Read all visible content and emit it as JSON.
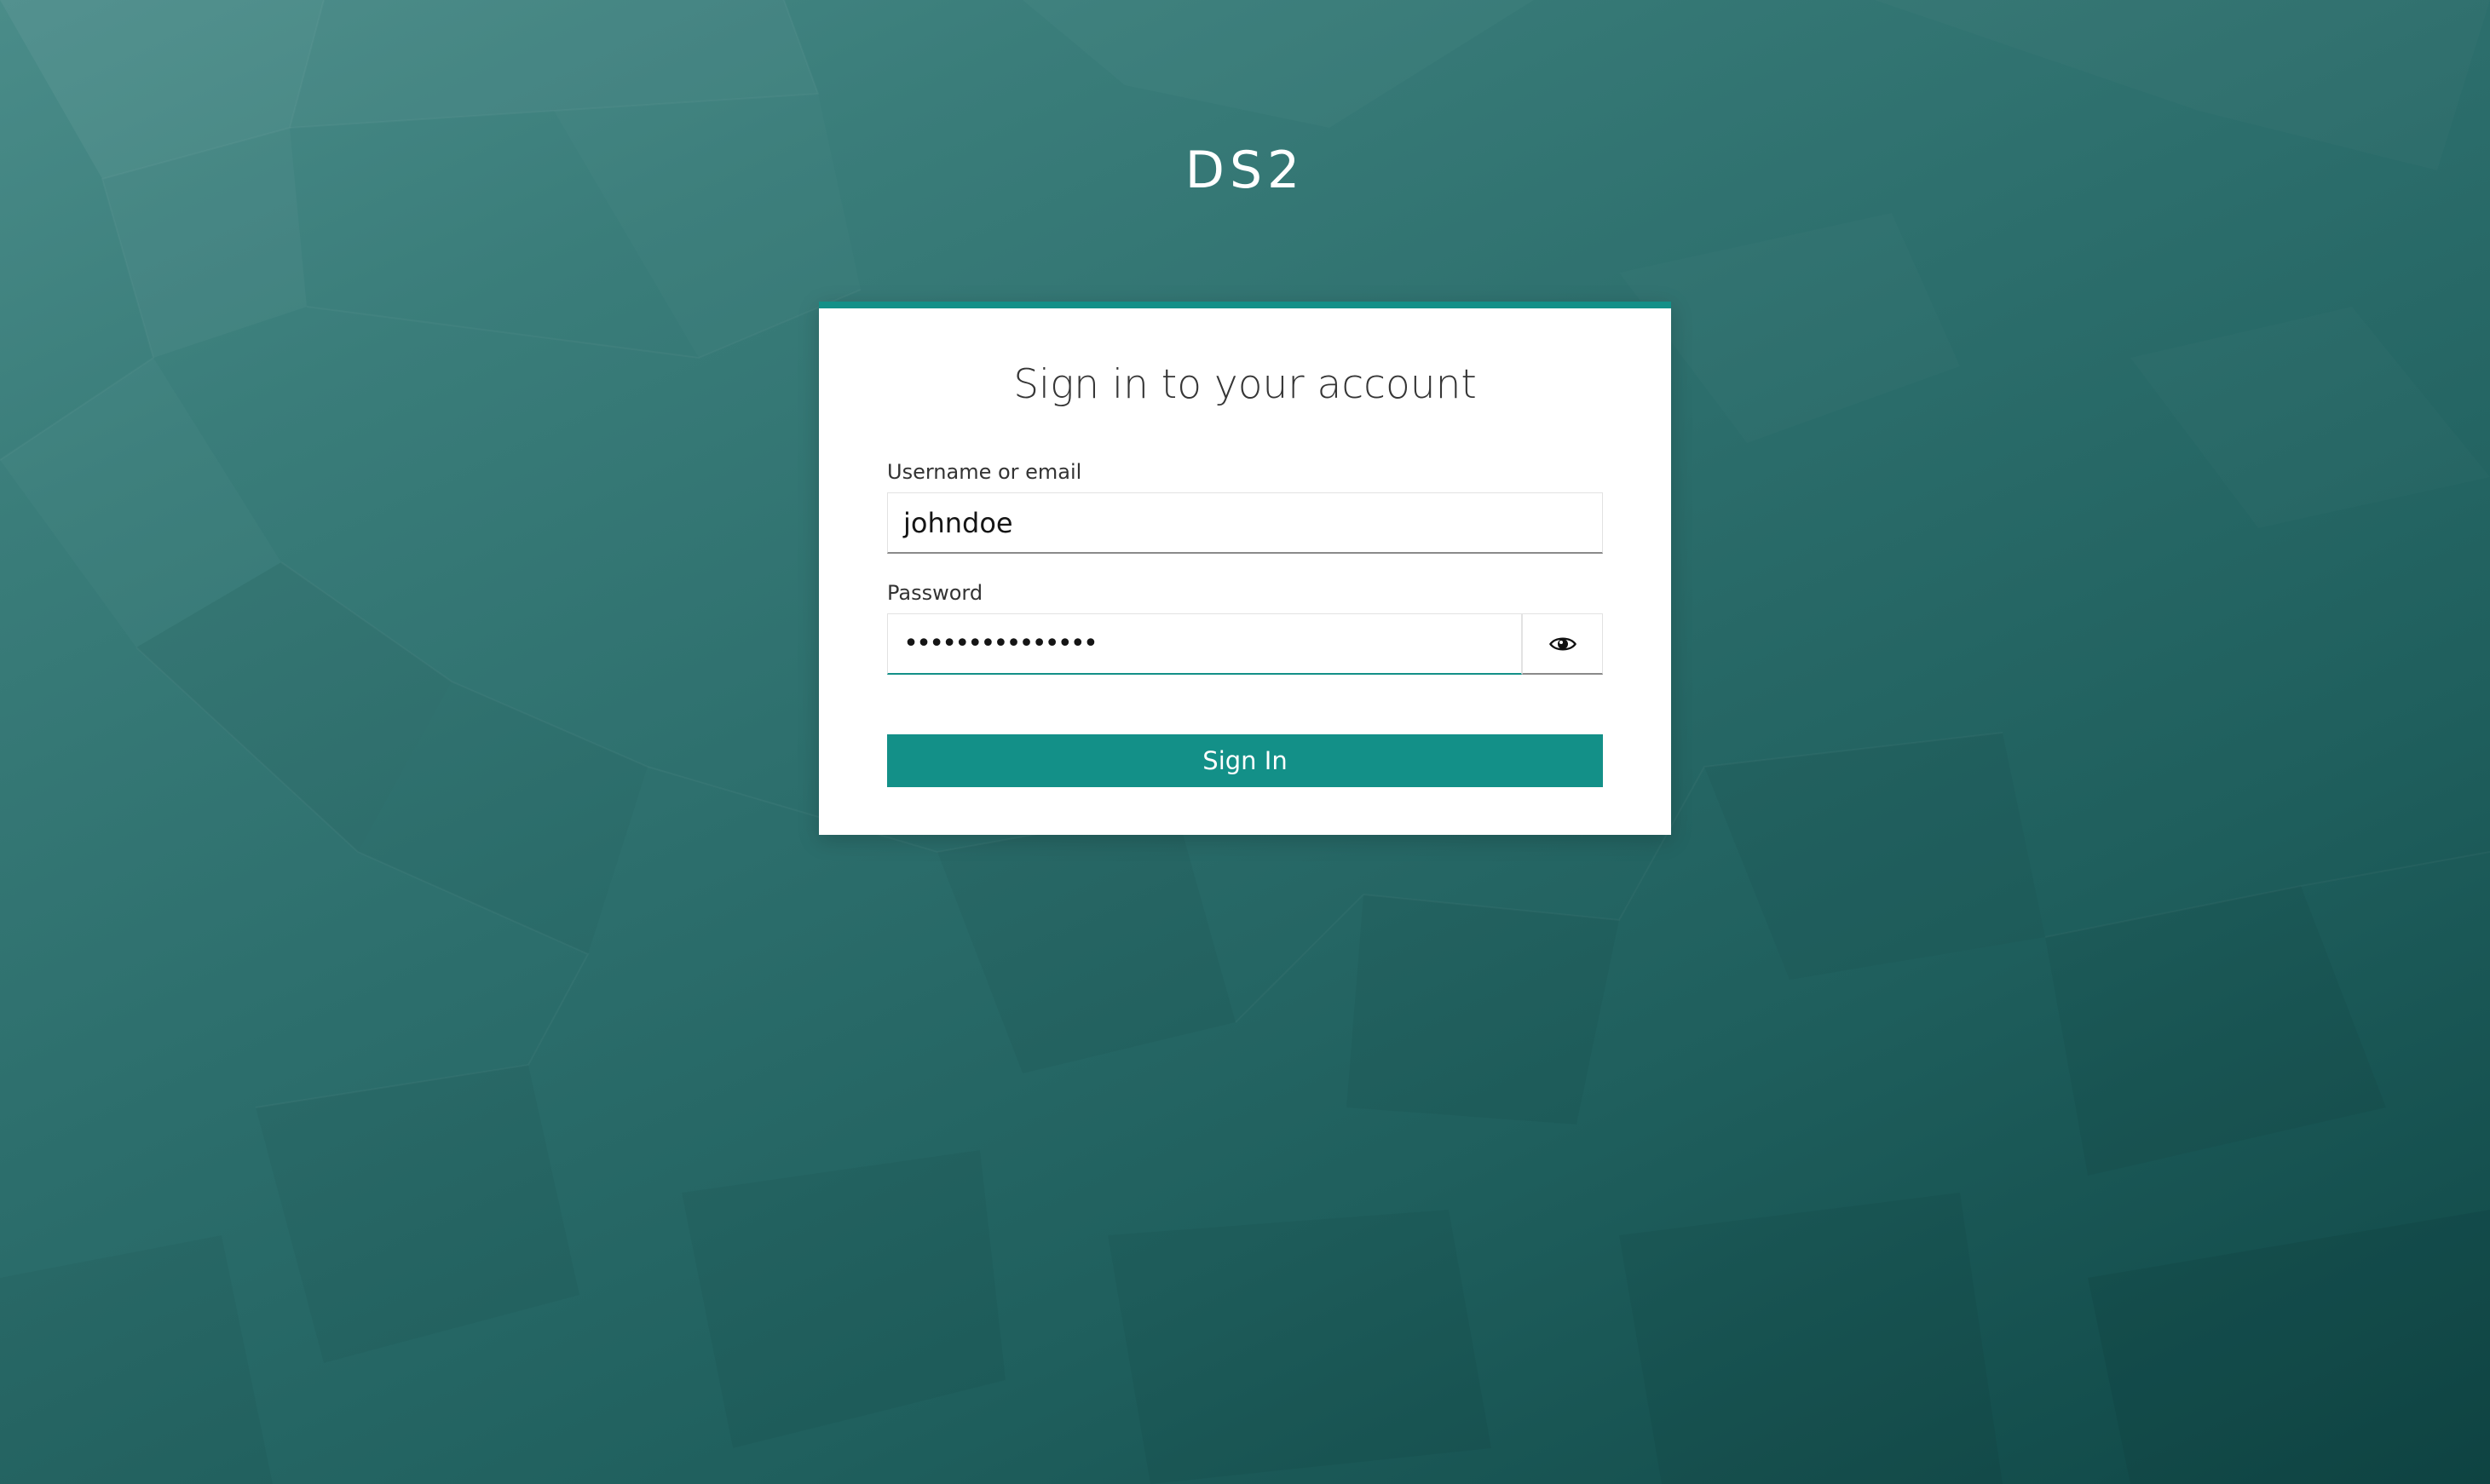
{
  "app": {
    "title": "DS2"
  },
  "login_card": {
    "heading": "Sign in to your account",
    "username": {
      "label": "Username or email",
      "value": "johndoe"
    },
    "password": {
      "label": "Password",
      "masked_value": "•••••••••••••••",
      "toggle_icon": "eye-icon"
    },
    "submit_label": "Sign In"
  },
  "colors": {
    "accent": "#139088",
    "background_light": "#4a8c89",
    "background_dark": "#0f4746",
    "card": "#ffffff"
  }
}
